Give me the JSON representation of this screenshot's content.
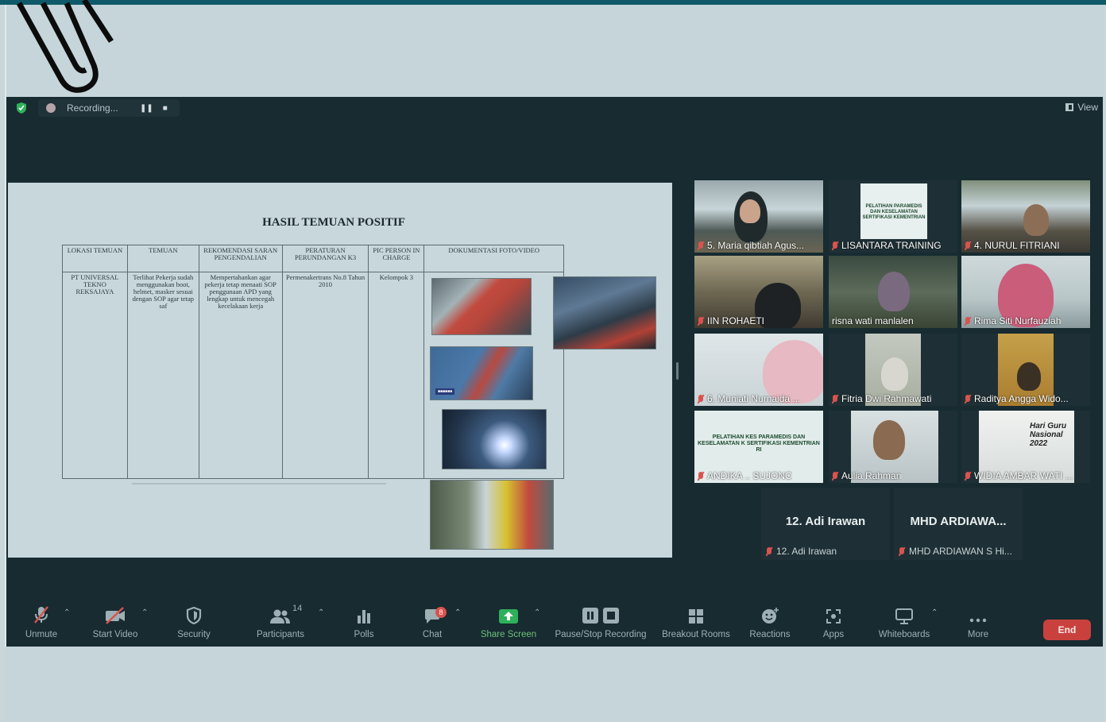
{
  "recording": {
    "label": "Recording..."
  },
  "view": {
    "label": "View"
  },
  "slide": {
    "title": "HASIL TEMUAN POSITIF",
    "headers": [
      "LOKASI TEMUAN",
      "TEMUAN",
      "REKOMENDASI SARAN PENGENDALIAN",
      "PERATURAN PERUNDANGAN K3",
      "PIC PERSON IN CHARGE",
      "DOKUMENTASI FOTO/VIDEO"
    ],
    "row": {
      "lokasi": "PT UNIVERSAL TEKNO REKSAJAYA",
      "temuan": "Terlihat Pekerja sudah menggunakan boot, helmet, masker sesuai dengan SOP agar tetap saf",
      "rekomendasi": "Mempertahankan agar pekerja tetap menaati SOP penggunaan APD yang lengkap untuk mencegah kecelakaan kerja",
      "peraturan": "Permenakertrans No.8 Tahun 2010",
      "pic": "Kelompok 3"
    }
  },
  "participants": [
    {
      "name": "5. Maria qibtiah Agus..."
    },
    {
      "name": "LISANTARA TRAINING",
      "banner": "PELATIHAN PARAMEDIS DAN KESELAMATAN SERTIFIKASI KEMENTRIAN"
    },
    {
      "name": "4. NURUL FITRIANI"
    },
    {
      "name": "IIN ROHAETI"
    },
    {
      "name": "risna wati manlalen"
    },
    {
      "name": "Rima Siti Nurfauziah"
    },
    {
      "name": "6. Muniati Nurnaida ..."
    },
    {
      "name": "Fitria Dwi Rahmawati"
    },
    {
      "name": "Raditya Angga Wido..."
    },
    {
      "name": "ANDIKA .. SUJONO",
      "banner": "PELATIHAN KES PARAMEDIS DAN KESELAMATAN K SERTIFIKASI KEMENTRIAN RI"
    },
    {
      "name": "Aulia Rahman"
    },
    {
      "name": "WIDIA AMBAR WATI ...",
      "poster": "Hari Guru Nasional 2022"
    }
  ],
  "name_tiles": [
    {
      "big": "12. Adi Irawan",
      "small": "12. Adi Irawan"
    },
    {
      "big": "MHD ARDIAWA...",
      "small": "MHD ARDIAWAN S Hi..."
    }
  ],
  "toolbar": {
    "unmute": "Unmute",
    "start_video": "Start Video",
    "security": "Security",
    "participants": "Participants",
    "participants_count": "14",
    "polls": "Polls",
    "chat": "Chat",
    "chat_badge": "8",
    "share_screen": "Share Screen",
    "pause_recording": "Pause/Stop Recording",
    "breakout": "Breakout Rooms",
    "reactions": "Reactions",
    "apps": "Apps",
    "whiteboards": "Whiteboards",
    "more": "More",
    "end": "End"
  },
  "colors": {
    "background": "#172b31",
    "share_green": "#2eb05a",
    "end_red": "#c9413d",
    "active_speaker": "#b7c94e"
  }
}
